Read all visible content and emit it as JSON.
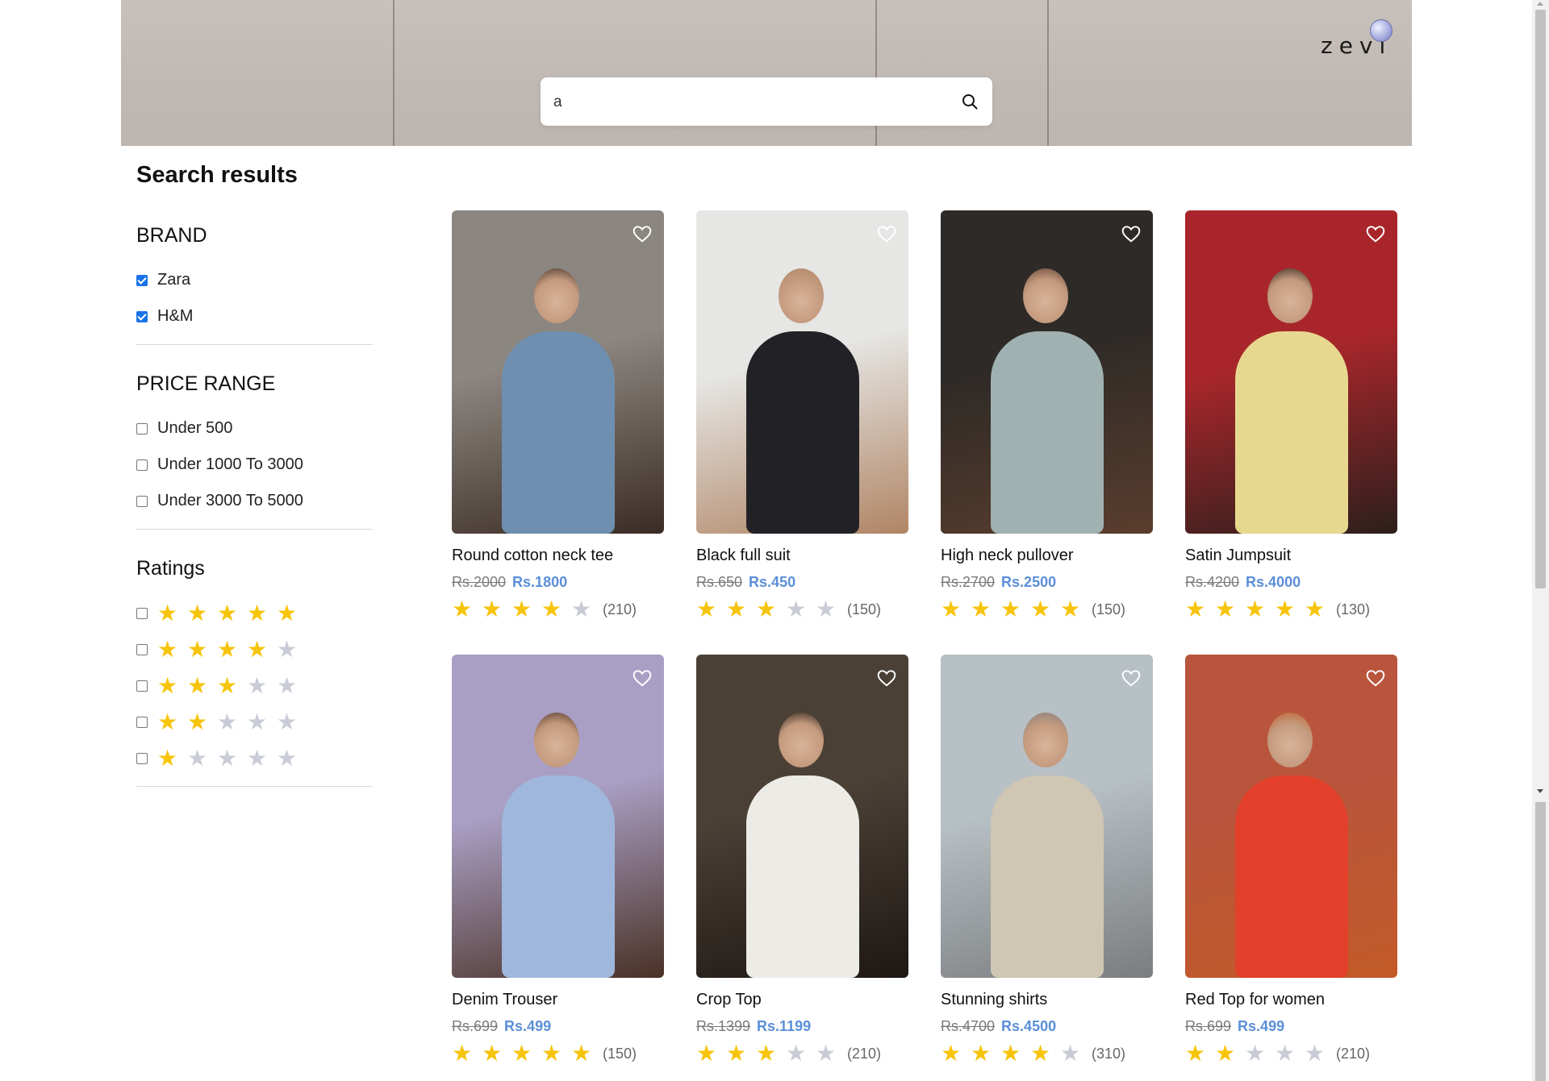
{
  "search": {
    "value": "a"
  },
  "logo": {
    "text": "zevi"
  },
  "results_title": "Search results",
  "filters": {
    "brand": {
      "heading": "BRAND",
      "options": [
        {
          "label": "Zara",
          "checked": true
        },
        {
          "label": "H&M",
          "checked": true
        }
      ]
    },
    "price": {
      "heading": "PRICE RANGE",
      "options": [
        {
          "label": "Under 500",
          "checked": false
        },
        {
          "label": "Under 1000 To 3000",
          "checked": false
        },
        {
          "label": "Under 3000 To 5000",
          "checked": false
        }
      ]
    },
    "ratings": {
      "heading": "Ratings",
      "options": [
        {
          "stars": 5,
          "checked": false
        },
        {
          "stars": 4,
          "checked": false
        },
        {
          "stars": 3,
          "checked": false
        },
        {
          "stars": 2,
          "checked": false
        },
        {
          "stars": 1,
          "checked": false
        }
      ]
    }
  },
  "products": [
    {
      "name": "Round cotton neck tee",
      "old_price": "Rs.2000",
      "new_price": "Rs.1800",
      "rating": 4,
      "count": "(210)",
      "colors": [
        "#8c8680",
        "#6e8fb0",
        "#3a2c24"
      ]
    },
    {
      "name": "Black full suit",
      "old_price": "Rs.650",
      "new_price": "Rs.450",
      "rating": 3,
      "count": "(150)",
      "colors": [
        "#e6e6e4",
        "#222226",
        "#b08565"
      ]
    },
    {
      "name": "High neck pullover",
      "old_price": "Rs.2700",
      "new_price": "Rs.2500",
      "rating": 5,
      "count": "(150)",
      "colors": [
        "#2e2a27",
        "#9fb1b0",
        "#5a3d2d"
      ]
    },
    {
      "name": "Satin Jumpsuit",
      "old_price": "Rs.4200",
      "new_price": "Rs.4000",
      "rating": 5,
      "count": "(130)",
      "colors": [
        "#a8262b",
        "#e7d88f",
        "#2c1f1c"
      ]
    },
    {
      "name": "Denim Trouser",
      "old_price": "Rs.699",
      "new_price": "Rs.499",
      "rating": 5,
      "count": "(150)",
      "colors": [
        "#a99fc4",
        "#9fb7dd",
        "#4a3126"
      ]
    },
    {
      "name": "Crop Top",
      "old_price": "Rs.1399",
      "new_price": "Rs.1199",
      "rating": 3,
      "count": "(210)",
      "colors": [
        "#4a4036",
        "#ecebe6",
        "#1e1713"
      ]
    },
    {
      "name": "Stunning shirts",
      "old_price": "Rs.4700",
      "new_price": "Rs.4500",
      "rating": 4,
      "count": "(310)",
      "colors": [
        "#b7c0c4",
        "#cfc6b3",
        "#7b7d80"
      ]
    },
    {
      "name": "Red Top for women",
      "old_price": "Rs.699",
      "new_price": "Rs.499",
      "rating": 2,
      "count": "(210)",
      "colors": [
        "#b9553d",
        "#e2402b",
        "#c25a27"
      ]
    }
  ]
}
